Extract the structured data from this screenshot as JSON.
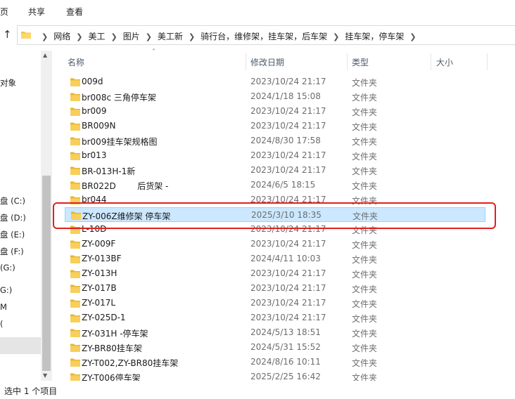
{
  "ribbon": {
    "tabs": [
      "页",
      "共享",
      "查看"
    ]
  },
  "address": {
    "crumbs": [
      "网络",
      "美工",
      "图片",
      "美工新",
      "骑行台，维修架，挂车架，后车架",
      "挂车架，停车架"
    ]
  },
  "nav": {
    "items": [
      "对象",
      "盘 (C:)",
      "盘 (D:)",
      "盘 (E:)",
      "盘 (F:)",
      "(G:)",
      "G:)",
      "M",
      "("
    ]
  },
  "columns": {
    "name": "名称",
    "date": "修改日期",
    "type": "类型",
    "size": "大小"
  },
  "files": [
    {
      "name": "009d",
      "date": "2023/10/24 21:17",
      "type": "文件夹"
    },
    {
      "name": "br008c 三角停车架",
      "date": "2024/1/18 15:08",
      "type": "文件夹"
    },
    {
      "name": "br009",
      "date": "2023/10/24 21:17",
      "type": "文件夹"
    },
    {
      "name": "BR009N",
      "date": "2023/10/24 21:17",
      "type": "文件夹"
    },
    {
      "name": "br009挂车架规格图",
      "date": "2024/8/30 17:58",
      "type": "文件夹"
    },
    {
      "name": "br013",
      "date": "2023/10/24 21:17",
      "type": "文件夹"
    },
    {
      "name": "BR-013H-1新",
      "date": "2023/10/24 21:17",
      "type": "文件夹"
    },
    {
      "name": "BR022D        后货架 -",
      "date": "2024/6/5 18:15",
      "type": "文件夹"
    },
    {
      "name": "br044",
      "date": "2023/10/24 21:17",
      "type": "文件夹"
    },
    {
      "name": "ZY-006Z维修架 停车架",
      "date": "2025/3/10 18:35",
      "type": "文件夹"
    },
    {
      "name": "L-10D",
      "date": "2023/10/24 21:17",
      "type": "文件夹"
    },
    {
      "name": "ZY-009F",
      "date": "2023/10/24 21:17",
      "type": "文件夹"
    },
    {
      "name": "ZY-013BF",
      "date": "2024/4/11 10:03",
      "type": "文件夹"
    },
    {
      "name": "ZY-013H",
      "date": "2023/10/24 21:17",
      "type": "文件夹"
    },
    {
      "name": "ZY-017B",
      "date": "2023/10/24 21:17",
      "type": "文件夹"
    },
    {
      "name": "ZY-017L",
      "date": "2023/10/24 21:17",
      "type": "文件夹"
    },
    {
      "name": "ZY-025D-1",
      "date": "2023/10/24 21:17",
      "type": "文件夹"
    },
    {
      "name": "ZY-031H -停车架",
      "date": "2024/5/13 18:51",
      "type": "文件夹"
    },
    {
      "name": "ZY-BR80挂车架",
      "date": "2024/5/31 15:52",
      "type": "文件夹"
    },
    {
      "name": "ZY-T002,ZY-BR80挂车架",
      "date": "2024/8/16 10:11",
      "type": "文件夹"
    },
    {
      "name": "ZY-T006停车架",
      "date": "2025/2/25 16:42",
      "type": "文件夹"
    }
  ],
  "selected_index": 9,
  "status": {
    "text": "选中 1 个项目"
  },
  "colors": {
    "selection_bg": "#cce8ff",
    "selection_border": "#99d1ff",
    "annotation": "#e02020",
    "folder": "#f5c542"
  }
}
